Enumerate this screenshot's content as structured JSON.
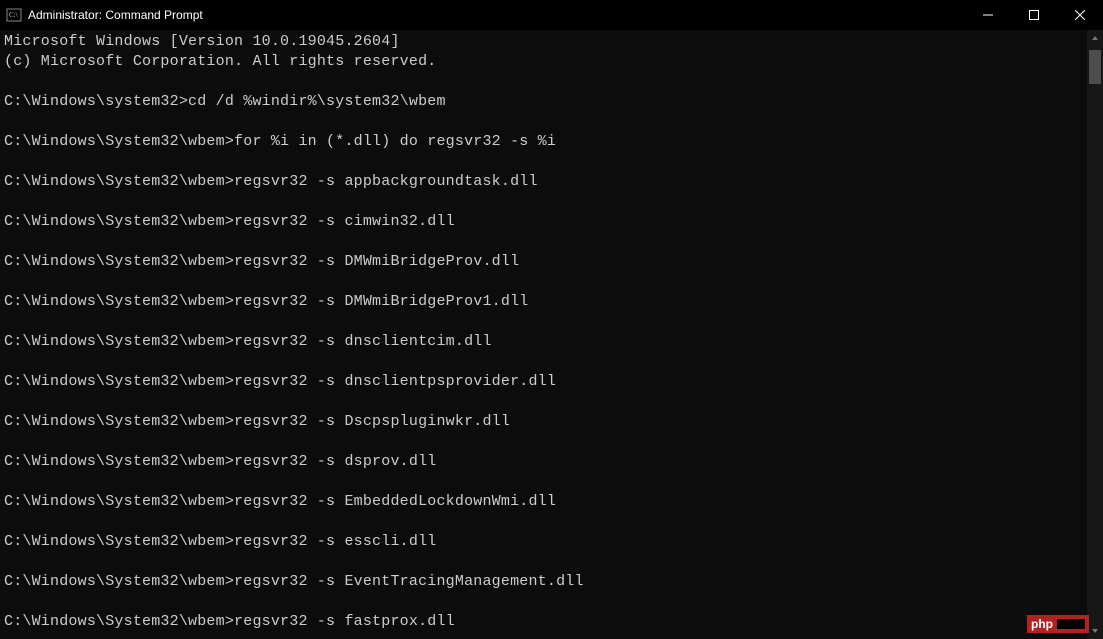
{
  "window": {
    "title": "Administrator: Command Prompt"
  },
  "console": {
    "lines": [
      "Microsoft Windows [Version 10.0.19045.2604]",
      "(c) Microsoft Corporation. All rights reserved.",
      "",
      "C:\\Windows\\system32>cd /d %windir%\\system32\\wbem",
      "",
      "C:\\Windows\\System32\\wbem>for %i in (*.dll) do regsvr32 -s %i",
      "",
      "C:\\Windows\\System32\\wbem>regsvr32 -s appbackgroundtask.dll",
      "",
      "C:\\Windows\\System32\\wbem>regsvr32 -s cimwin32.dll",
      "",
      "C:\\Windows\\System32\\wbem>regsvr32 -s DMWmiBridgeProv.dll",
      "",
      "C:\\Windows\\System32\\wbem>regsvr32 -s DMWmiBridgeProv1.dll",
      "",
      "C:\\Windows\\System32\\wbem>regsvr32 -s dnsclientcim.dll",
      "",
      "C:\\Windows\\System32\\wbem>regsvr32 -s dnsclientpsprovider.dll",
      "",
      "C:\\Windows\\System32\\wbem>regsvr32 -s Dscpspluginwkr.dll",
      "",
      "C:\\Windows\\System32\\wbem>regsvr32 -s dsprov.dll",
      "",
      "C:\\Windows\\System32\\wbem>regsvr32 -s EmbeddedLockdownWmi.dll",
      "",
      "C:\\Windows\\System32\\wbem>regsvr32 -s esscli.dll",
      "",
      "C:\\Windows\\System32\\wbem>regsvr32 -s EventTracingManagement.dll",
      "",
      "C:\\Windows\\System32\\wbem>regsvr32 -s fastprox.dll"
    ]
  },
  "watermark": {
    "label": "php"
  }
}
